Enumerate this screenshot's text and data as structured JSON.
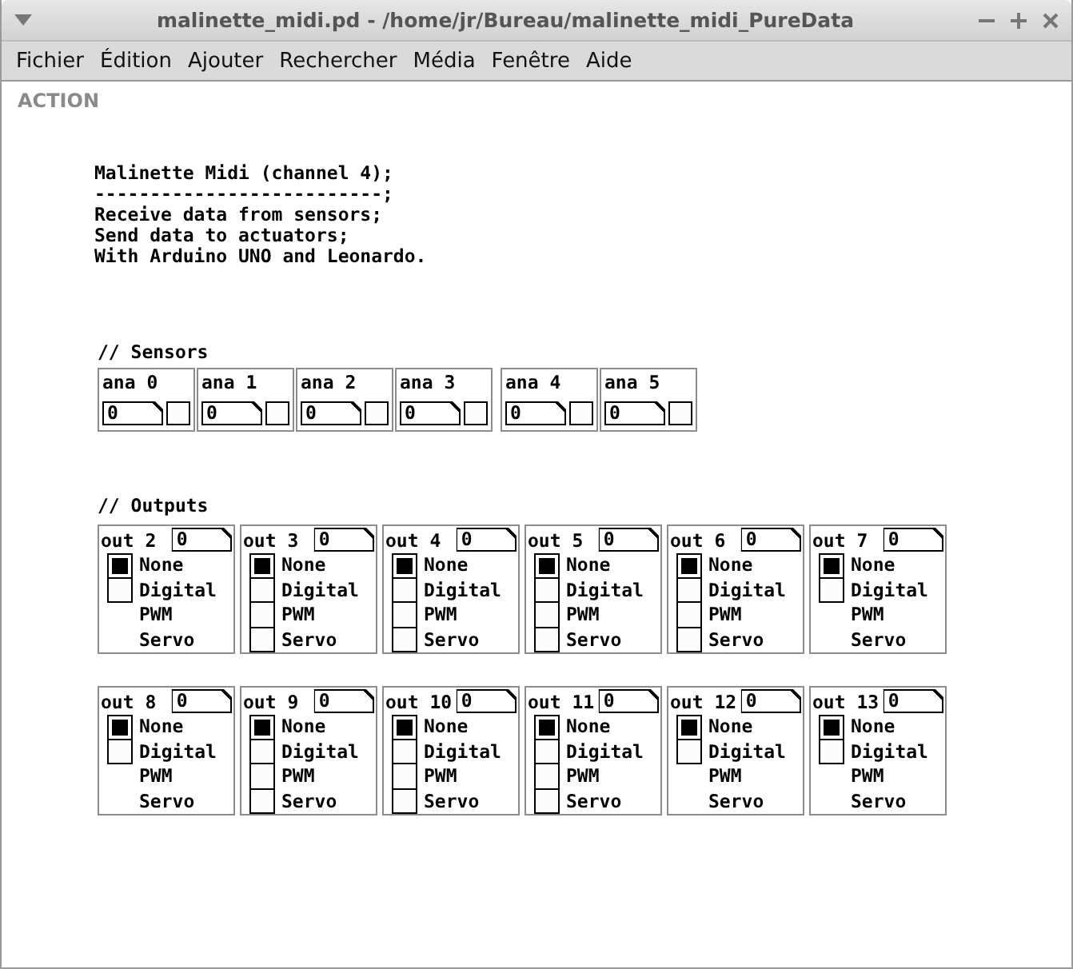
{
  "window": {
    "title": "malinette_midi.pd  - /home/jr/Bureau/malinette_midi_PureData"
  },
  "menu": [
    "Fichier",
    "Édition",
    "Ajouter",
    "Rechercher",
    "Média",
    "Fenêtre",
    "Aide"
  ],
  "mode_label": "ACTION",
  "comment": [
    "Malinette Midi (channel 4);",
    "--------------------------;",
    "Receive data from sensors;",
    "Send data to actuators;",
    "With Arduino UNO and Leonardo."
  ],
  "sensors": {
    "heading": "// Sensors",
    "items": [
      {
        "label": "ana 0",
        "value": "0"
      },
      {
        "label": "ana 1",
        "value": "0"
      },
      {
        "label": "ana 2",
        "value": "0"
      },
      {
        "label": "ana 3",
        "value": "0"
      },
      {
        "label": "ana 4",
        "value": "0"
      },
      {
        "label": "ana 5",
        "value": "0"
      }
    ]
  },
  "outputs": {
    "heading": "// Outputs",
    "rows": [
      [
        {
          "label": "out 2",
          "value": "0",
          "radio": [
            {
              "label": "None",
              "selected": true
            },
            {
              "label": "Digital",
              "selected": false
            }
          ],
          "notes": [
            "PWM",
            "Servo"
          ]
        },
        {
          "label": "out 3",
          "value": "0",
          "radio": [
            {
              "label": "None",
              "selected": true
            },
            {
              "label": "Digital",
              "selected": false
            },
            {
              "label": "PWM",
              "selected": false
            },
            {
              "label": "Servo",
              "selected": false
            }
          ]
        },
        {
          "label": "out 4",
          "value": "0",
          "radio": [
            {
              "label": "None",
              "selected": true
            },
            {
              "label": "Digital",
              "selected": false
            },
            {
              "label": "PWM",
              "selected": false
            },
            {
              "label": "Servo",
              "selected": false
            }
          ]
        },
        {
          "label": "out 5",
          "value": "0",
          "radio": [
            {
              "label": "None",
              "selected": true
            },
            {
              "label": "Digital",
              "selected": false
            },
            {
              "label": "PWM",
              "selected": false
            },
            {
              "label": "Servo",
              "selected": false
            }
          ]
        },
        {
          "label": "out 6",
          "value": "0",
          "radio": [
            {
              "label": "None",
              "selected": true
            },
            {
              "label": "Digital",
              "selected": false
            },
            {
              "label": "PWM",
              "selected": false
            },
            {
              "label": "Servo",
              "selected": false
            }
          ]
        },
        {
          "label": "out 7",
          "value": "0",
          "radio": [
            {
              "label": "None",
              "selected": true
            },
            {
              "label": "Digital",
              "selected": false
            }
          ],
          "notes": [
            "PWM",
            "Servo"
          ]
        }
      ],
      [
        {
          "label": "out 8",
          "value": "0",
          "radio": [
            {
              "label": "None",
              "selected": true
            },
            {
              "label": "Digital",
              "selected": false
            }
          ],
          "notes": [
            "PWM",
            "Servo"
          ]
        },
        {
          "label": "out 9",
          "value": "0",
          "radio": [
            {
              "label": "None",
              "selected": true
            },
            {
              "label": "Digital",
              "selected": false
            },
            {
              "label": "PWM",
              "selected": false
            },
            {
              "label": "Servo",
              "selected": false
            }
          ]
        },
        {
          "label": "out 10",
          "value": "0",
          "radio": [
            {
              "label": "None",
              "selected": true
            },
            {
              "label": "Digital",
              "selected": false
            },
            {
              "label": "PWM",
              "selected": false
            },
            {
              "label": "Servo",
              "selected": false
            }
          ]
        },
        {
          "label": "out 11",
          "value": "0",
          "radio": [
            {
              "label": "None",
              "selected": true
            },
            {
              "label": "Digital",
              "selected": false
            },
            {
              "label": "PWM",
              "selected": false
            },
            {
              "label": "Servo",
              "selected": false
            }
          ]
        },
        {
          "label": "out 12",
          "value": "0",
          "radio": [
            {
              "label": "None",
              "selected": true
            },
            {
              "label": "Digital",
              "selected": false
            }
          ],
          "notes": [
            "PWM",
            "Servo"
          ]
        },
        {
          "label": "out 13",
          "value": "0",
          "radio": [
            {
              "label": "None",
              "selected": true
            },
            {
              "label": "Digital",
              "selected": false
            }
          ],
          "notes": [
            "PWM",
            "Servo"
          ]
        }
      ]
    ]
  }
}
